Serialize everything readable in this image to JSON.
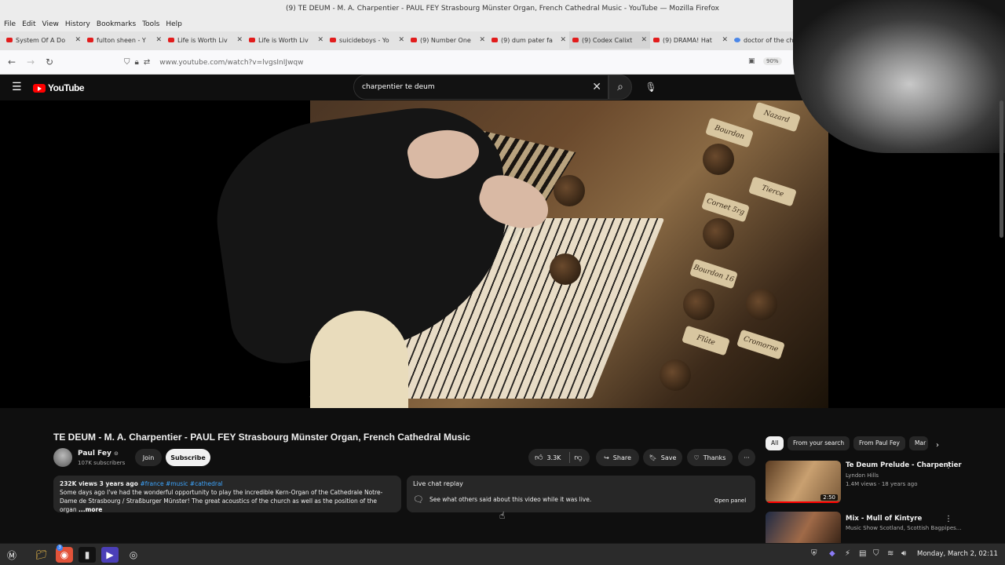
{
  "window": {
    "title": "(9) TE DEUM - M. A. Charpentier - PAUL FEY Strasbourg Münster Organ, French Cathedral Music - YouTube — Mozilla Firefox"
  },
  "menubar": [
    "File",
    "Edit",
    "View",
    "History",
    "Bookmarks",
    "Tools",
    "Help"
  ],
  "tabs": [
    {
      "label": "System Of A Do",
      "favicon": "youtube-icon"
    },
    {
      "label": "fulton sheen - Y",
      "favicon": "youtube-icon"
    },
    {
      "label": "Life is Worth Liv",
      "favicon": "youtube-icon"
    },
    {
      "label": "Life is Worth Liv",
      "favicon": "youtube-icon"
    },
    {
      "label": "suicideboys - Yo",
      "favicon": "youtube-icon"
    },
    {
      "label": "(9) Number One",
      "favicon": "youtube-icon"
    },
    {
      "label": "(9) dum pater fa",
      "favicon": "youtube-icon"
    },
    {
      "label": "(9) Codex Calixt",
      "favicon": "youtube-icon"
    },
    {
      "label": "(9) DRAMA! Hat",
      "favicon": "youtube-icon"
    },
    {
      "label": "doctor of the ch",
      "favicon": "google-icon"
    }
  ],
  "navbar": {
    "url": "www.youtube.com/watch?v=lvgsInIJwqw",
    "zoom": "90%"
  },
  "youtube": {
    "logo_text": "YouTube",
    "search_value": "charpentier te deum"
  },
  "video": {
    "stop_labels": [
      "Nazard",
      "Bourdon",
      "Tierce",
      "Cornet 5rg",
      "Bourdon 16",
      "Flûte",
      "Cromorne"
    ]
  },
  "info": {
    "title": "TE DEUM - M. A. Charpentier - PAUL FEY Strasbourg Münster Organ, French Cathedral Music",
    "channel": "Paul Fey",
    "verified_mark": "⊙",
    "subscribers": "107K subscribers",
    "join": "Join",
    "subscribe": "Subscribe",
    "likes": "3.3K",
    "share": "Share",
    "save": "Save",
    "thanks": "Thanks",
    "more": "···"
  },
  "description": {
    "meta": "232K views  3 years ago",
    "tags": "#france #music #cathedral",
    "text": "Some days ago I've had the wonderful opportunity to play the incredible Kern-Organ of the Cathedrale Notre-Dame de Strasbourg / Straßburger Münster! The great acoustics of the church as well as the position of the organ",
    "more": "...more"
  },
  "live_chat": {
    "title": "Live chat replay",
    "text": "See what others said about this video while it was live.",
    "button": "Open panel"
  },
  "chips": [
    "All",
    "From your search",
    "From Paul Fey",
    "Mar"
  ],
  "recommendations": [
    {
      "title": "Te Deum Prelude - Charpentier",
      "channel": "Lyndon Hills",
      "meta": "1.4M views · 18 years ago",
      "duration": "2:50"
    },
    {
      "title": "Mix - Mull of Kintyre",
      "channel": "Music Show Scotland, Scottish Bagpipes..."
    }
  ],
  "taskbar": {
    "clock": "Monday, March  2, 02:11",
    "badge": "3"
  }
}
